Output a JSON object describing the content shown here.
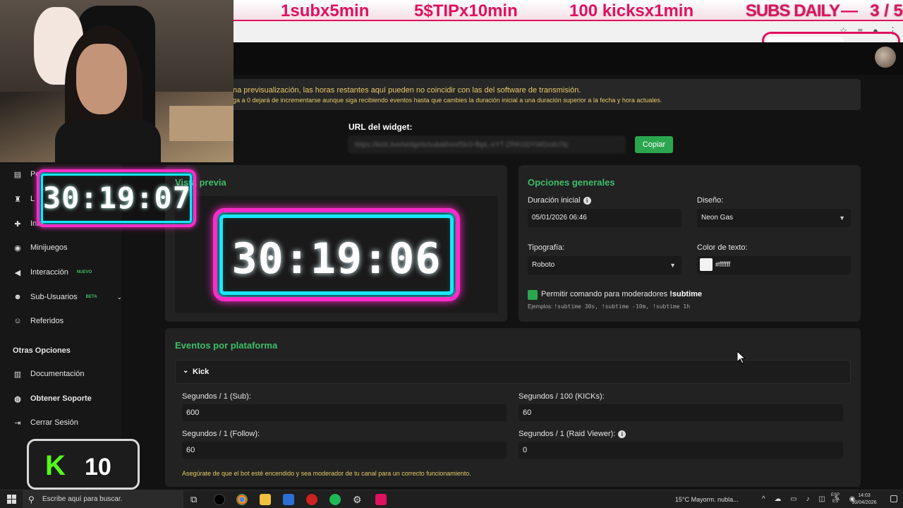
{
  "banner": {
    "promo_1": "1subx5min",
    "promo_2": "5$TIPx10min",
    "promo_3": "100 kicksx1min",
    "subs_daily": "SUBS DAILY",
    "counter": "3 / 5"
  },
  "warning": {
    "line_1": "na previsualización, las horas restantes aquí pueden no coincidir con las del software de transmisión.",
    "line_2": "ga a 0 dejará de incrementarse aunque siga recibiendo eventos hasta que cambies la duración inicial a una duración superior a la fecha y hora actuales."
  },
  "widget_url": {
    "label": "URL del widget:",
    "value": "https://kick.live/widgets/subathon/f3c0-fbpL-eYT-ZRKGDYWDcdn7kj",
    "copy_label": "Copiar"
  },
  "preview": {
    "title": "Vista previa",
    "timer": "30:19:06"
  },
  "options": {
    "title": "Opciones generales",
    "duration_label": "Duración inicial",
    "duration_value": "05/01/2026 06:46",
    "design_label": "Diseño:",
    "design_value": "Neon Gas",
    "typography_label": "Tipografía:",
    "typography_value": "Roboto",
    "text_color_label": "Color de texto:",
    "text_color_value": "#ffffff",
    "mod_command_label": "Permitir comando para moderadores",
    "mod_command": "!subtime",
    "examples_prefix": "Ejemplos:",
    "examples": "!subtime 30s, !subtime -10m, !subtime 1h"
  },
  "events": {
    "title": "Eventos por plataforma",
    "platform": "Kick",
    "sub_label": "Segundos / 1 (Sub):",
    "sub_value": "600",
    "kicks_label": "Segundos / 100 (KICKs):",
    "kicks_value": "60",
    "follow_label": "Segundos / 1 (Follow):",
    "follow_value": "60",
    "raid_label": "Segundos / 1 (Raid Viewer):",
    "raid_value": "0",
    "note": "Asegúrate de que el bot esté encendido y sea moderador de tu canal para un correcto funcionamiento."
  },
  "sidebar": {
    "items": [
      {
        "label": "Pe",
        "icon": "id-card-icon"
      },
      {
        "label": "L",
        "icon": "trophy-icon"
      },
      {
        "label": "Inte",
        "icon": "puzzle-icon"
      },
      {
        "label": "Minijuegos",
        "icon": "gamepad-icon"
      },
      {
        "label": "Interacción",
        "icon": "megaphone-icon",
        "badge": "NUEVO"
      },
      {
        "label": "Sub-Usuarios",
        "icon": "users-icon",
        "badge": "BETA"
      },
      {
        "label": "Referidos",
        "icon": "group-icon"
      }
    ],
    "section_title": "Otras Opciones",
    "other_items": [
      {
        "label": "Documentación",
        "icon": "book-icon"
      },
      {
        "label": "Obtener Soporte",
        "icon": "support-icon"
      },
      {
        "label": "Cerrar Sesión",
        "icon": "logout-icon"
      }
    ]
  },
  "overlay": {
    "timer_small": "30:19:07",
    "kick_count": "10"
  },
  "taskbar": {
    "search_placeholder": "Escribe aquí para buscar.",
    "weather": "15°C  Mayorm. nubla...",
    "lang_1": "ESP",
    "lang_2": "ES",
    "time": "14:03",
    "date": "30/04/2026"
  },
  "colors": {
    "accent_green": "#3fbf6a",
    "kick_green": "#53fc18",
    "neon_pink": "#ff2bc8",
    "neon_cyan": "#17e8ff",
    "banner_pink": "#e0115f"
  }
}
